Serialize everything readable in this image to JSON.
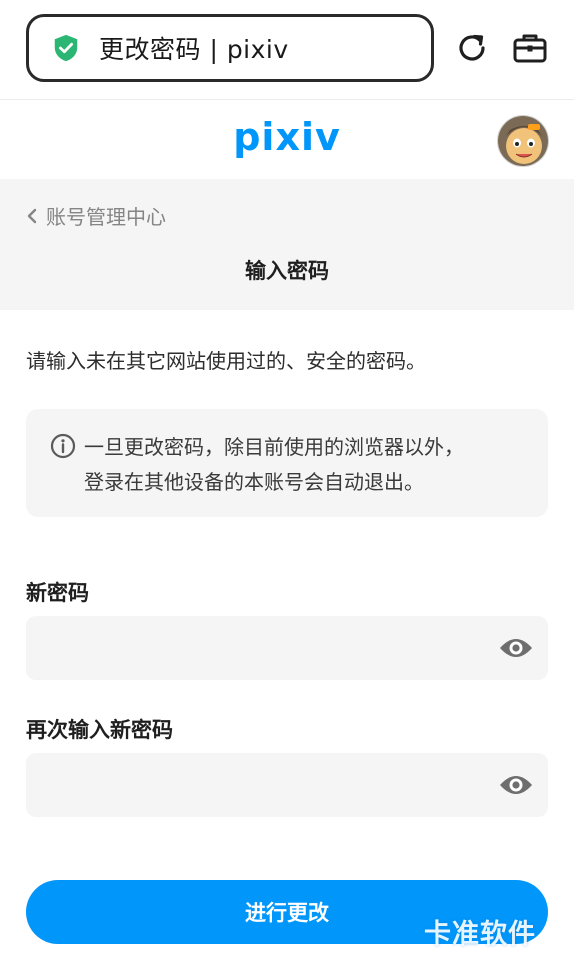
{
  "browser": {
    "url_title": "更改密码 | pixiv",
    "shield_icon": "shield-check-icon",
    "reload_icon": "reload-icon",
    "toolbox_icon": "toolbox-icon"
  },
  "header": {
    "logo": "pixiv",
    "avatar_icon": "user-avatar"
  },
  "nav": {
    "back_label": "账号管理中心",
    "page_title": "输入密码"
  },
  "content": {
    "intro": "请输入未在其它网站使用过的、安全的密码。",
    "notice_line1": "一旦更改密码，除目前使用的浏览器以外，",
    "notice_line2": "登录在其他设备的本账号会自动退出。"
  },
  "form": {
    "new_password_label": "新密码",
    "new_password_value": "",
    "confirm_password_label": "再次输入新密码",
    "confirm_password_value": "",
    "submit_label": "进行更改"
  },
  "watermark": "卡准软件",
  "colors": {
    "accent": "#0096fa",
    "shield": "#2bb673",
    "panel": "#f5f5f5"
  }
}
